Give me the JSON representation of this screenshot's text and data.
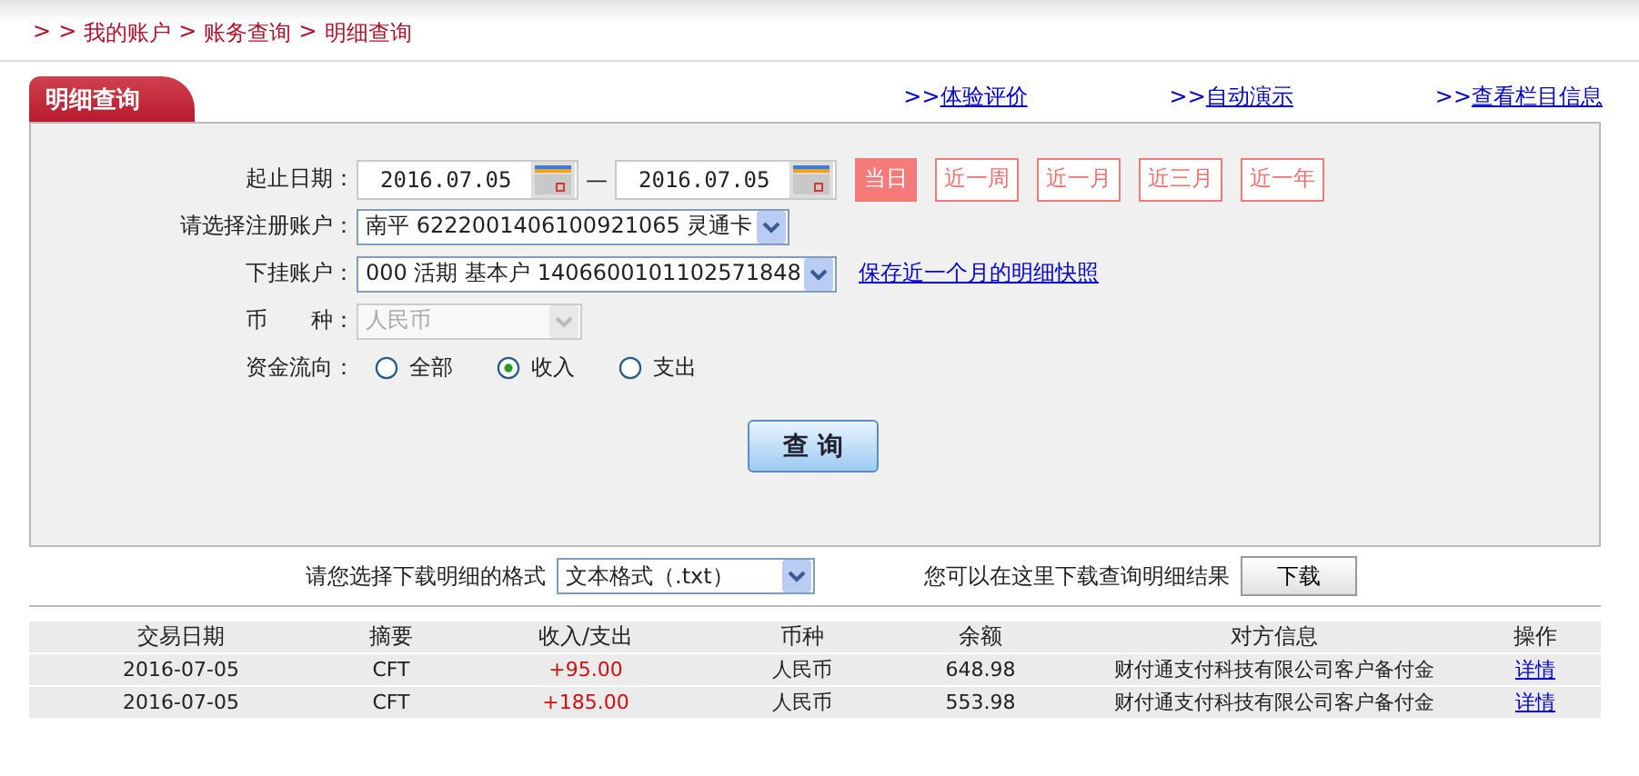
{
  "breadcrumb": [
    ">",
    ">",
    "我的账户",
    ">",
    "账务查询",
    ">",
    "明细查询"
  ],
  "panel": {
    "title": "明细查询",
    "links": [
      {
        "prefix": ">>",
        "label": "体验评价"
      },
      {
        "prefix": ">>",
        "label": "自动演示"
      },
      {
        "prefix": ">>",
        "label": "查看栏目信息"
      }
    ]
  },
  "date_range": {
    "label": "起止日期：",
    "start": "2016.07.05",
    "separator": "—",
    "end": "2016.07.05"
  },
  "quick_ranges": [
    {
      "label": "当日",
      "selected": true
    },
    {
      "label": "近一周",
      "selected": false
    },
    {
      "label": "近一月",
      "selected": false
    },
    {
      "label": "近三月",
      "selected": false
    },
    {
      "label": "近一年",
      "selected": false
    }
  ],
  "fields": [
    {
      "label": "请选择注册账户：",
      "value": "南平  6222001406100921065 灵通卡",
      "disabled": false
    },
    {
      "label": "下挂账户：",
      "value": "000 活期 基本户 1406600101102571848",
      "disabled": false,
      "link": "保存近一个月的明细快照"
    },
    {
      "label": "币　　种：",
      "value": "人民币",
      "disabled": true
    }
  ],
  "flow": {
    "label": "资金流向：",
    "options": [
      {
        "label": "全部",
        "selected": false
      },
      {
        "label": "收入",
        "selected": true
      },
      {
        "label": "支出",
        "selected": false
      }
    ]
  },
  "query_button": "查 询",
  "download": {
    "label": "请您选择下载明细的格式",
    "format": "文本格式（.txt）",
    "hint": "您可以在这里下载查询明细结果",
    "button": "下载"
  },
  "table": {
    "columns": [
      "交易日期",
      "摘要",
      "收入/支出",
      "币种",
      "余额",
      "对方信息",
      "操作"
    ],
    "rows": [
      {
        "cells": [
          "2016-07-05",
          "CFT",
          "+95.00",
          "人民币",
          "648.98",
          "财付通支付科技有限公司客户备付金",
          "详情"
        ]
      },
      {
        "cells": [
          "2016-07-05",
          "CFT",
          "+185.00",
          "人民币",
          "553.98",
          "财付通支付科技有限公司客户备付金",
          "详情"
        ]
      }
    ]
  }
}
